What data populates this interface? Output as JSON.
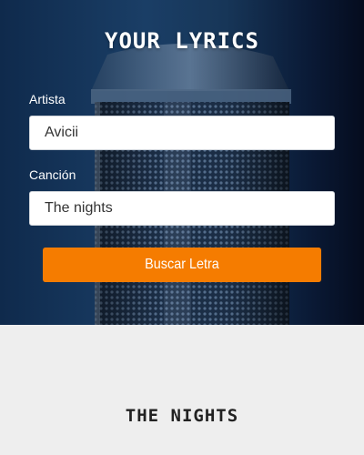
{
  "header": {
    "title": "YOUR LYRICS"
  },
  "form": {
    "artist": {
      "label": "Artista",
      "value": "Avicii"
    },
    "song": {
      "label": "Canción",
      "value": "The nights"
    },
    "submit_label": "Buscar Letra"
  },
  "result": {
    "title": "THE NIGHTS"
  },
  "colors": {
    "accent": "#f57c00",
    "hero_dark": "#0a1a36",
    "hero_mid": "#1a3e66",
    "page_background": "#eeeeee"
  }
}
